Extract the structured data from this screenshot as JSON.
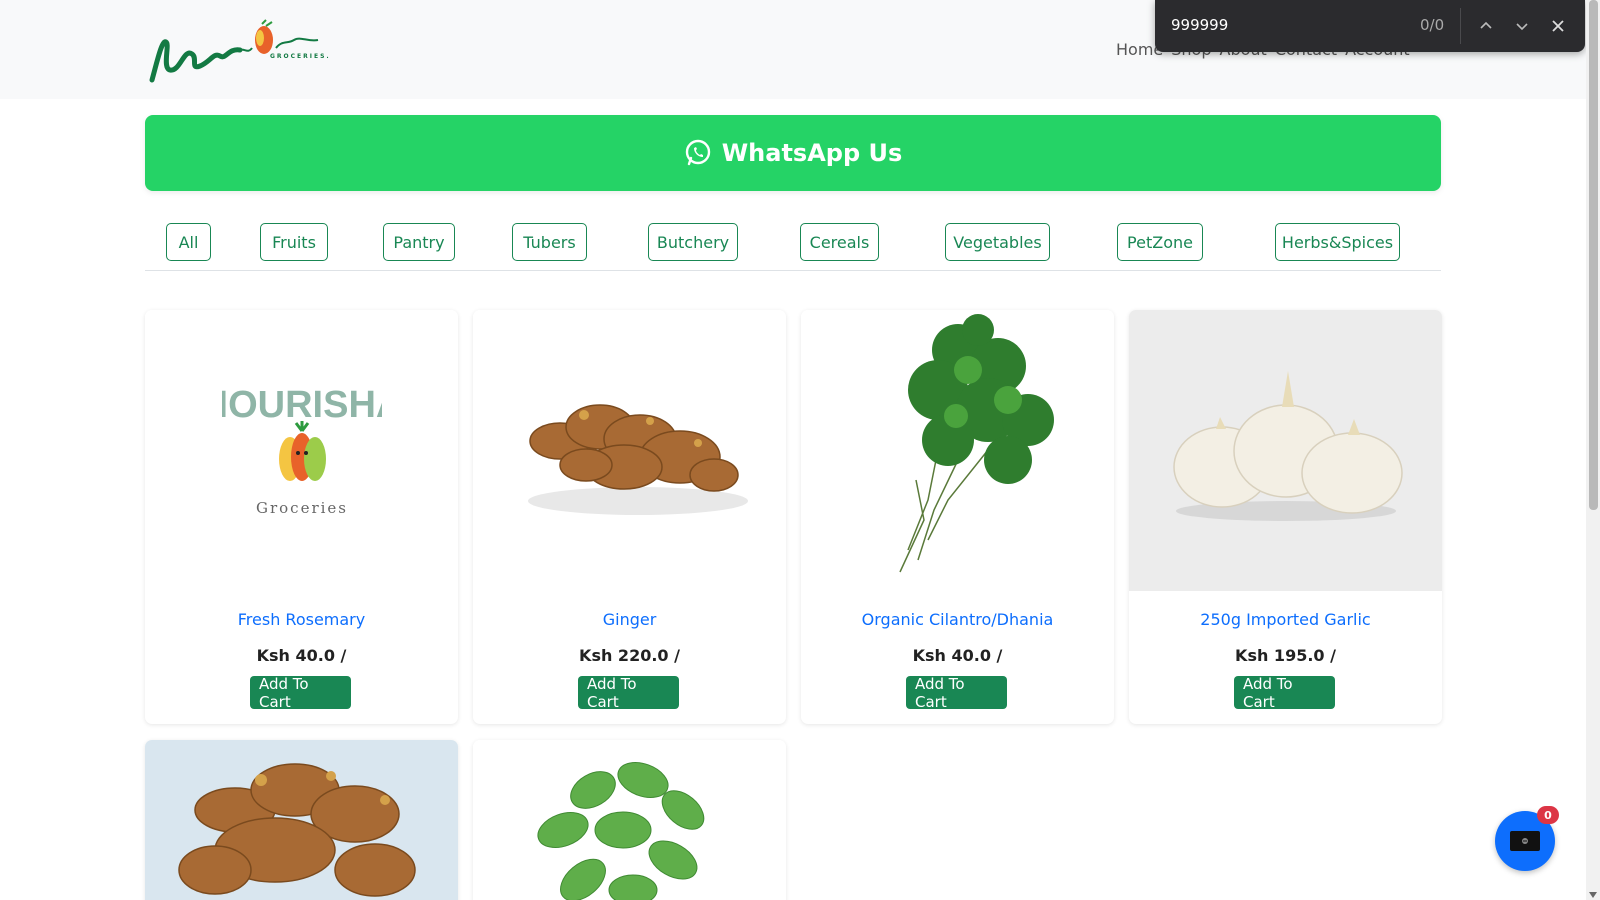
{
  "header": {
    "logo_alt": "Nourisha Groceries",
    "nav": [
      {
        "label": "Home"
      },
      {
        "label": "Shop"
      },
      {
        "label": "About"
      },
      {
        "label": "Contact"
      },
      {
        "label": "Account"
      }
    ]
  },
  "find_bar": {
    "query": "999999",
    "count": "0/0",
    "icons": [
      "chevron-up-icon",
      "chevron-down-icon",
      "close-icon"
    ]
  },
  "whatsapp": {
    "label": "WhatsApp Us",
    "icon": "whatsapp-icon",
    "color": "#25d366"
  },
  "categories": [
    {
      "label": "All"
    },
    {
      "label": "Fruits"
    },
    {
      "label": "Pantry"
    },
    {
      "label": "Tubers"
    },
    {
      "label": "Butchery"
    },
    {
      "label": "Cereals"
    },
    {
      "label": "Vegetables"
    },
    {
      "label": "PetZone"
    },
    {
      "label": "Herbs&Spices"
    }
  ],
  "products": [
    {
      "name": "Fresh Rosemary",
      "price": "Ksh 40.0 /",
      "button": "Add To Cart",
      "image": "nourisha-logo-placeholder",
      "logo_text": "NOURISHA",
      "logo_sub": "Groceries"
    },
    {
      "name": "Ginger",
      "price": "Ksh 220.0 /",
      "button": "Add To Cart",
      "image": "ginger-photo"
    },
    {
      "name": "Organic Cilantro/Dhania",
      "price": "Ksh 40.0 /",
      "button": "Add To Cart",
      "image": "cilantro-photo"
    },
    {
      "name": "250g Imported Garlic",
      "price": "Ksh 195.0 /",
      "button": "Add To Cart",
      "image": "garlic-photo"
    },
    {
      "name": "",
      "image": "ginger-photo-blue"
    },
    {
      "name": "",
      "image": "mint-photo"
    }
  ],
  "cart": {
    "count": "0",
    "icon": "cart-icon"
  },
  "colors": {
    "accent_green": "#198754",
    "link_blue": "#0d6efd",
    "badge_red": "#dc3545"
  }
}
